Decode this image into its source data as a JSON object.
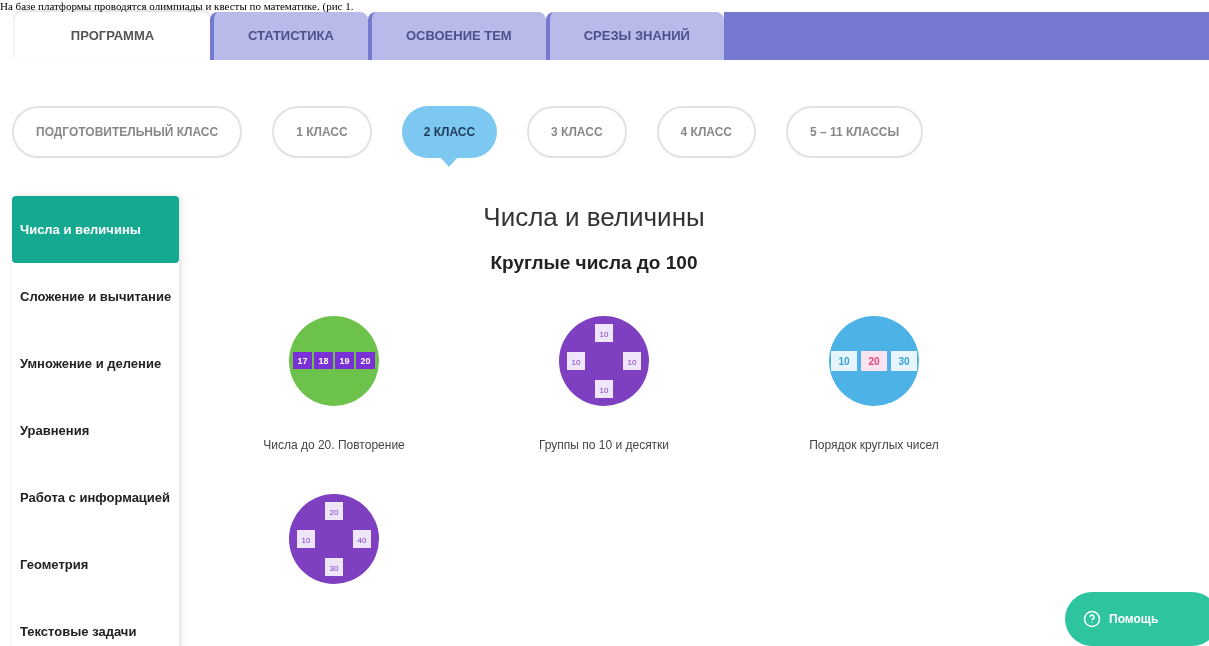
{
  "document_text": "На базе платформы проводятся олимпиады и квесты по математике. (рис 1.",
  "tabs": [
    {
      "label": "ПРОГРАММА",
      "selected": true
    },
    {
      "label": "СТАТИСТИКА",
      "selected": false
    },
    {
      "label": "ОСВОЕНИЕ ТЕМ",
      "selected": false
    },
    {
      "label": "СРЕЗЫ ЗНАНИЙ",
      "selected": false
    }
  ],
  "grades": [
    {
      "label": "ПОДГОТОВИТЕЛЬНЫЙ КЛАСС",
      "selected": false
    },
    {
      "label": "1 КЛАСС",
      "selected": false
    },
    {
      "label": "2 КЛАСС",
      "selected": true
    },
    {
      "label": "3 КЛАСС",
      "selected": false
    },
    {
      "label": "4 КЛАСС",
      "selected": false
    },
    {
      "label": "5 – 11 КЛАССЫ",
      "selected": false
    }
  ],
  "sidebar": {
    "items": [
      {
        "label": "Числа и величины",
        "selected": true
      },
      {
        "label": "Сложение и вычитание",
        "selected": false
      },
      {
        "label": "Умножение и деление",
        "selected": false
      },
      {
        "label": "Уравнения",
        "selected": false
      },
      {
        "label": "Работа с информацией",
        "selected": false
      },
      {
        "label": "Геометрия",
        "selected": false
      },
      {
        "label": "Текстовые задачи",
        "selected": false
      }
    ]
  },
  "section_title": "Числа и величины",
  "topic_group_title": "Круглые числа до 100",
  "topics": [
    {
      "kind": "row",
      "color": "#6cc24a",
      "tiles": [
        "17",
        "18",
        "19",
        "20"
      ],
      "label": "Числа до 20. Повторение"
    },
    {
      "kind": "cross",
      "color": "#7e3fc0",
      "tiles": [
        "10",
        "10",
        "10",
        "10"
      ],
      "label": "Группы по 10 и десятки"
    },
    {
      "kind": "sequence",
      "color": "#4db3e6",
      "tiles": [
        "10",
        "20",
        "30"
      ],
      "label": "Порядок круглых чисел"
    },
    {
      "kind": "cross",
      "color": "#7e3fc0",
      "tiles": [
        "20",
        "10",
        "40",
        "30"
      ]
    }
  ],
  "help_button": {
    "label": "Помощь"
  }
}
